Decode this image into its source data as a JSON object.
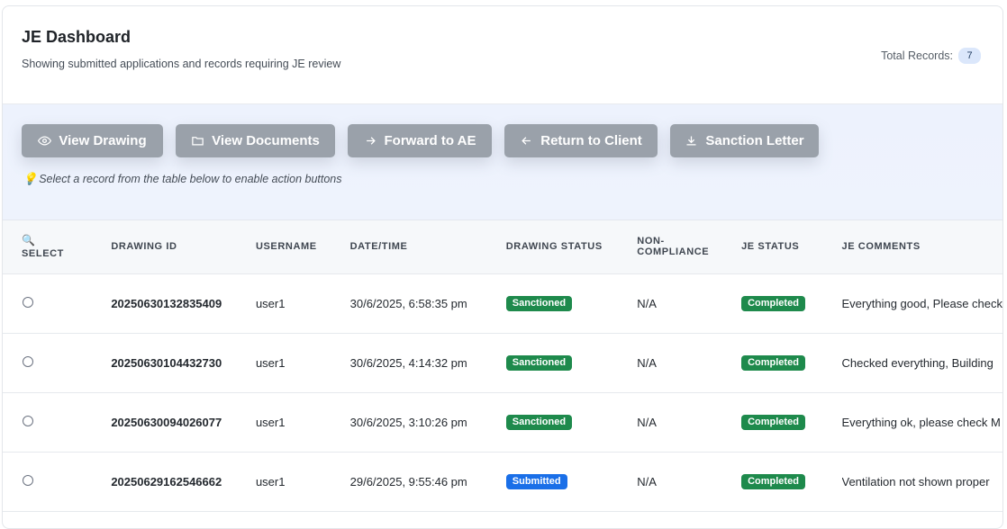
{
  "header": {
    "title": "JE Dashboard",
    "subtitle": "Showing submitted applications and records requiring JE review",
    "total_label": "Total Records:",
    "total_count": "7"
  },
  "actions": {
    "buttons": [
      {
        "label": "View Drawing",
        "icon": "eye-icon"
      },
      {
        "label": "View Documents",
        "icon": "folder-icon"
      },
      {
        "label": "Forward to AE",
        "icon": "arrow-right-icon"
      },
      {
        "label": "Return to Client",
        "icon": "arrow-left-icon"
      },
      {
        "label": "Sanction Letter",
        "icon": "download-icon"
      }
    ],
    "hint": "Select a record from the table below to enable action buttons"
  },
  "table": {
    "columns": [
      "SELECT",
      "DRAWING ID",
      "USERNAME",
      "DATE/TIME",
      "DRAWING STATUS",
      "NON-COMPLIANCE",
      "JE STATUS",
      "JE COMMENTS"
    ],
    "rows": [
      {
        "id": "20250630132835409",
        "user": "user1",
        "datetime": "30/6/2025, 6:58:35 pm",
        "status": "Sanctioned",
        "noncompliance": "N/A",
        "je_status": "Completed",
        "comment": "Everything good, Please check"
      },
      {
        "id": "20250630104432730",
        "user": "user1",
        "datetime": "30/6/2025, 4:14:32 pm",
        "status": "Sanctioned",
        "noncompliance": "N/A",
        "je_status": "Completed",
        "comment": "Checked everything, Building"
      },
      {
        "id": "20250630094026077",
        "user": "user1",
        "datetime": "30/6/2025, 3:10:26 pm",
        "status": "Sanctioned",
        "noncompliance": "N/A",
        "je_status": "Completed",
        "comment": "Everything ok, please check M"
      },
      {
        "id": "20250629162546662",
        "user": "user1",
        "datetime": "29/6/2025, 9:55:46 pm",
        "status": "Submitted",
        "noncompliance": "N/A",
        "je_status": "Completed",
        "comment": "Ventilation not shown proper"
      }
    ]
  },
  "colors": {
    "sanctioned": "#1e8a4c",
    "submitted": "#1a6fe8",
    "completed": "#1e8a4c",
    "button_disabled": "#9aa1aa"
  }
}
